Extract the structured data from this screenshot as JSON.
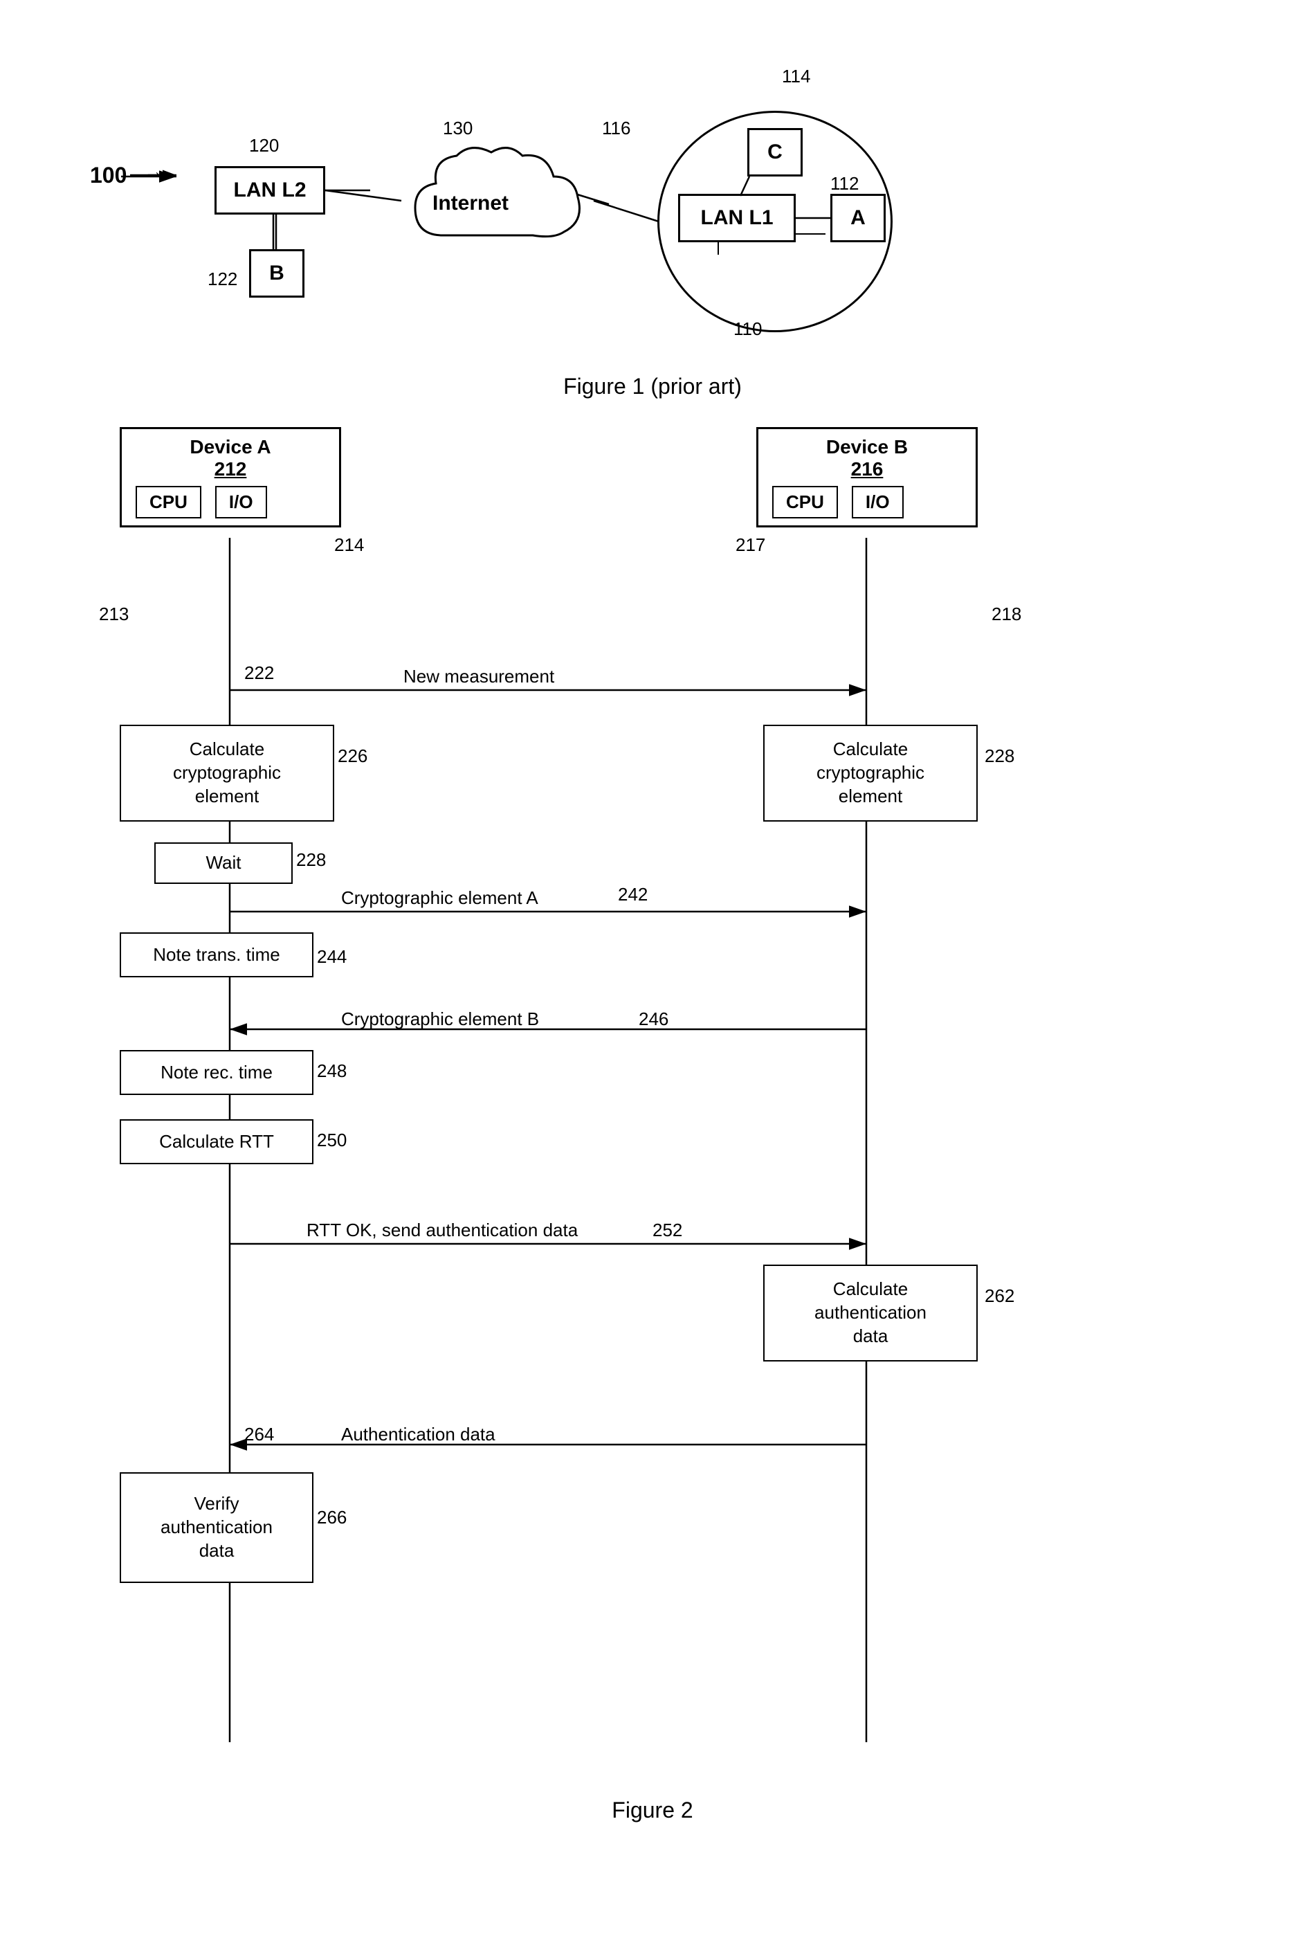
{
  "figure1": {
    "caption": "Figure 1 (prior art)",
    "label_100": "100",
    "label_110": "110",
    "label_112": "112",
    "label_114": "114",
    "label_116": "116",
    "label_120": "120",
    "label_122": "122",
    "label_130": "130",
    "lan_l2": "LAN L2",
    "internet": "Internet",
    "lan_l1": "LAN L1",
    "node_a": "A",
    "node_b": "B",
    "node_c": "C"
  },
  "figure2": {
    "caption": "Figure 2",
    "device_a_label": "Device A",
    "device_a_num": "212",
    "device_b_label": "Device B",
    "device_b_num": "216",
    "cpu_label": "CPU",
    "io_label": "I/O",
    "label_213": "213",
    "label_214": "214",
    "label_217": "217",
    "label_218": "218",
    "label_222": "222",
    "msg_new_measurement": "New measurement",
    "label_226": "226",
    "box_calc_crypto_a": "Calculate\ncryptographic\nelement",
    "label_228_wait": "228",
    "box_wait": "Wait",
    "label_228_calc": "228",
    "box_calc_crypto_b": "Calculate\ncryptographic\nelement",
    "label_242": "242",
    "msg_crypto_a": "Cryptographic element A",
    "label_244": "244",
    "box_note_trans": "Note trans. time",
    "label_246": "246",
    "msg_crypto_b": "Cryptographic element B",
    "label_248": "248",
    "box_note_rec": "Note rec. time",
    "label_250": "250",
    "box_calc_rtt": "Calculate RTT",
    "label_252": "252",
    "msg_rtt_ok": "RTT OK, send authentication data",
    "label_262": "262",
    "box_calc_auth": "Calculate\nauthentication\ndata",
    "label_264": "264",
    "msg_auth_data": "Authentication data",
    "label_266": "266",
    "box_verify_auth": "Verify\nauthentication\ndata"
  }
}
